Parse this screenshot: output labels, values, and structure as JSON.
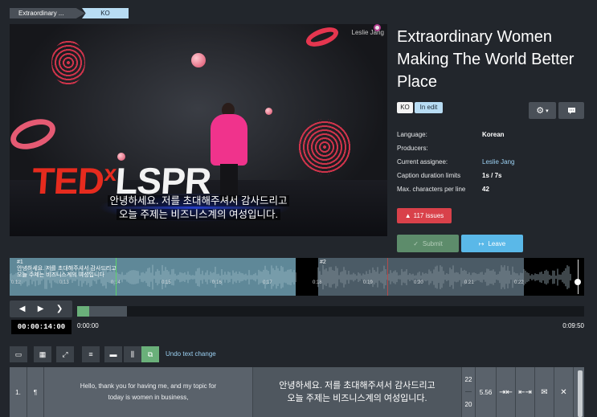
{
  "breadcrumb": {
    "video": "Extraordinary ...",
    "language": "KO"
  },
  "video": {
    "watermark": "Leslie Jang",
    "logo_red": "TED",
    "logo_x": "x",
    "logo_white": "LSPR",
    "subtitle_line1": "안녕하세요. 저를 초대해주셔서 감사드리고",
    "subtitle_line2": "오늘 주제는 비즈니스계의 여성입니다."
  },
  "panel": {
    "title": "Extraordinary Women Making The World Better Place",
    "lang_badge": "KO",
    "status_badge": "In edit",
    "meta": [
      {
        "key": "Language:",
        "value": "Korean"
      },
      {
        "key": "Producers:",
        "value": ""
      },
      {
        "key": "Current assignee:",
        "value": "Leslie Jang"
      },
      {
        "key": "Caption duration limits",
        "value": "1s / 7s"
      },
      {
        "key": "Max. characters per line",
        "value": "42"
      }
    ],
    "issues_label": "117 issues",
    "submit_label": "Submit",
    "leave_label": "Leave"
  },
  "waveform": {
    "seg1_id": "#1",
    "seg1_line1": "안녕하세요. 저를 초대해주셔서 감사드리고",
    "seg1_line2": "오늘 주제는 비즈니스계의 여성입니다",
    "seg2_id": "#2",
    "ticks": [
      "0:12",
      "0:13",
      "0:14",
      "0:15",
      "0:16",
      "0:17",
      "0:18",
      "0:19",
      "0:20",
      "0:21",
      "0:22"
    ]
  },
  "player": {
    "timecode": "00:00:14:00",
    "start_time": "0:00:00",
    "end_time": "0:09:50",
    "progress_fraction": 0.024
  },
  "toolbar": {
    "undo_label": "Undo text change"
  },
  "caption_row": {
    "number": "1.",
    "paragraph_mark": "¶",
    "source": "Hello, thank you for having me, and my topic for today is women in business,",
    "target_line1": "안녕하세요. 저를 초대해주셔서 감사드리고",
    "target_line2": "오늘 주제는 비즈니스계의 여성입니다.",
    "chars_line1": "22",
    "chars_line2": "20",
    "duration": "5.56"
  },
  "colors": {
    "background": "#22262c",
    "accent_blue": "#5ab8e8",
    "submit_green": "#5d8c6b",
    "issues_red": "#d9414a"
  }
}
